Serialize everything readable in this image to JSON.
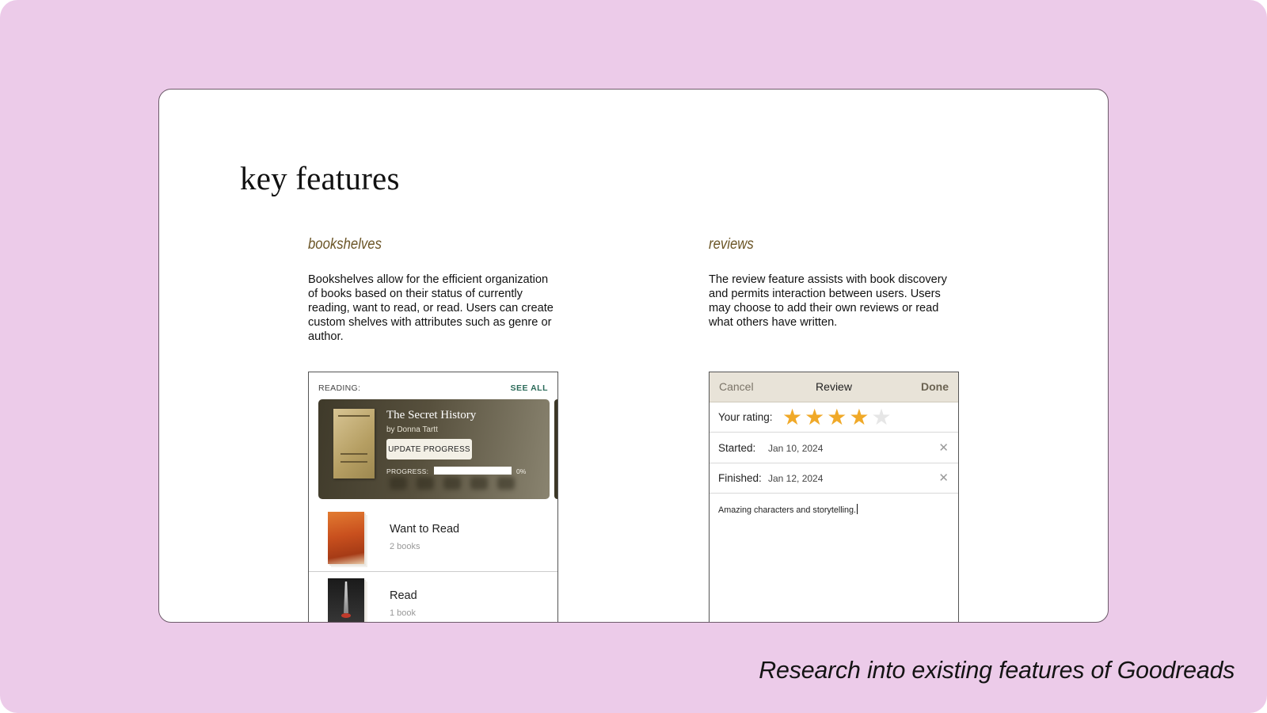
{
  "slide": {
    "title": "key features",
    "caption": "Research into existing features of Goodreads",
    "background_color": "#eccbe9"
  },
  "bookshelves": {
    "heading": "bookshelves",
    "body": "Bookshelves allow for the efficient organization of books based on their status of currently reading, want to read, or read.  Users can create custom shelves with attributes such as genre or author.",
    "reading_label": "READING:",
    "see_all": "SEE ALL",
    "current_book": {
      "title": "The Secret History",
      "author": "by Donna Tartt",
      "update_button": "UPDATE PROGRESS",
      "progress_label": "PROGRESS:",
      "progress_percent": "0%",
      "progress_value": 0
    },
    "shelves": [
      {
        "name": "Want to Read",
        "count": "2 books",
        "cover_icon": "catcher-in-the-rye-cover"
      },
      {
        "name": "Read",
        "count": "1 book",
        "cover_icon": "dark-book-cover"
      }
    ]
  },
  "reviews": {
    "heading": "reviews",
    "body": "The review feature assists with book discovery and permits interaction between users.  Users may choose to add their own reviews or read what others have written.",
    "nav": {
      "cancel": "Cancel",
      "title": "Review",
      "done": "Done"
    },
    "rating_label": "Your rating:",
    "rating": 4,
    "rating_max": 5,
    "started_label": "Started:",
    "started_date": "Jan 10, 2024",
    "finished_label": "Finished:",
    "finished_date": "Jan 12, 2024",
    "review_text": "Amazing characters and storytelling.",
    "star_color": "#f0a928"
  }
}
